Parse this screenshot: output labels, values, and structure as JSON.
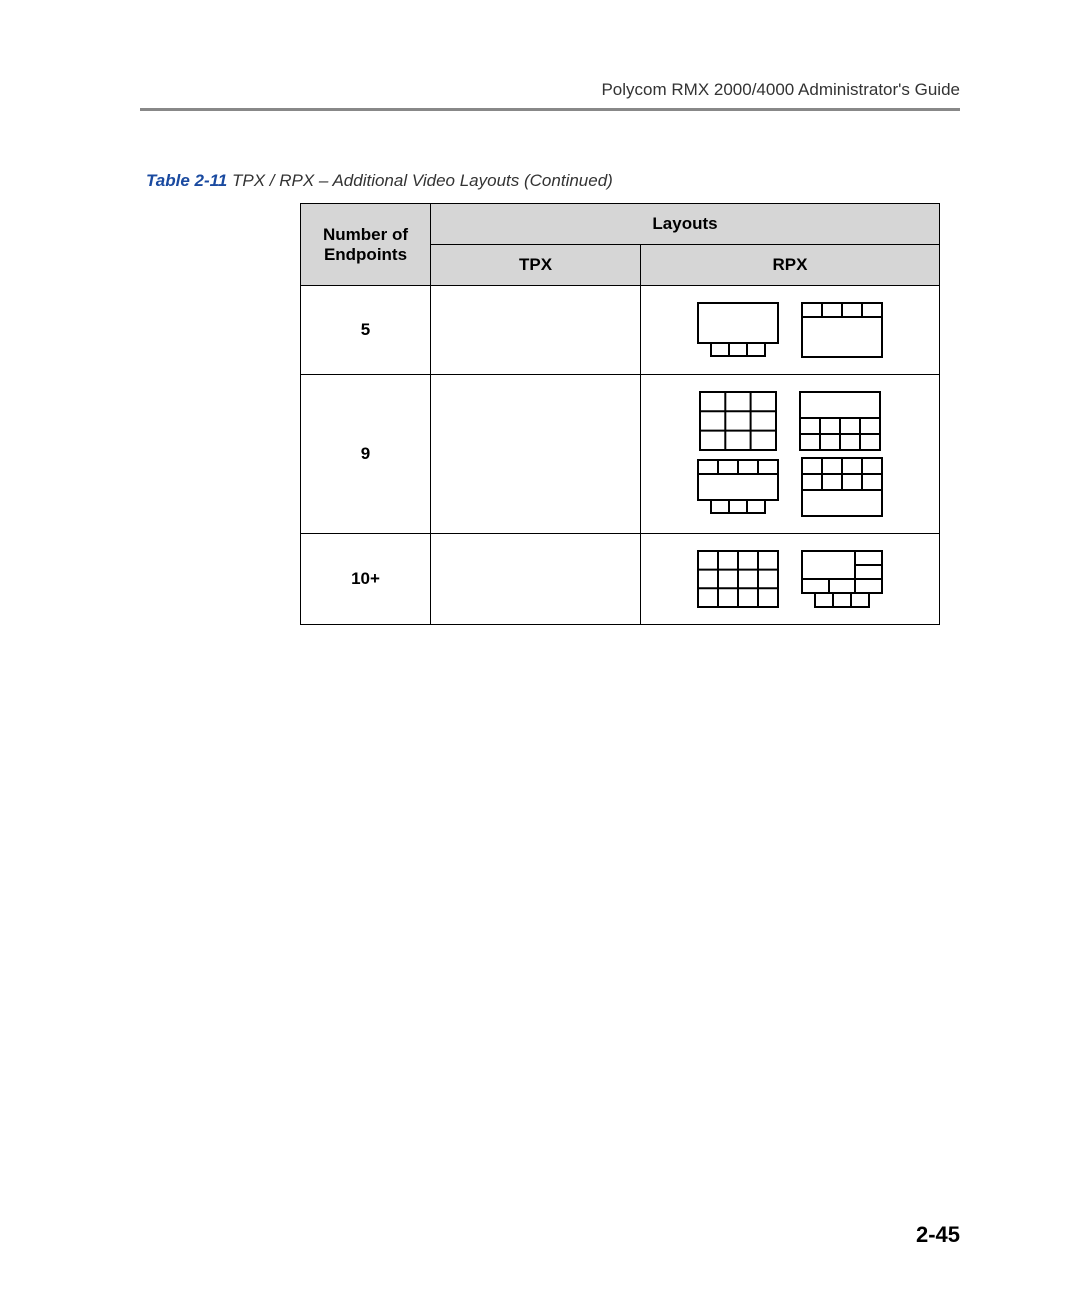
{
  "header": {
    "title": "Polycom RMX 2000/4000 Administrator's Guide"
  },
  "caption": {
    "label": "Table 2-11",
    "text": " TPX / RPX – Additional Video Layouts (Continued)"
  },
  "table": {
    "col_endpoints": "Number of Endpoints",
    "col_layouts": "Layouts",
    "col_tpx": "TPX",
    "col_rpx": "RPX",
    "rows": [
      {
        "endpoints": "5"
      },
      {
        "endpoints": "9"
      },
      {
        "endpoints": "10+"
      }
    ]
  },
  "page_number": "2-45"
}
